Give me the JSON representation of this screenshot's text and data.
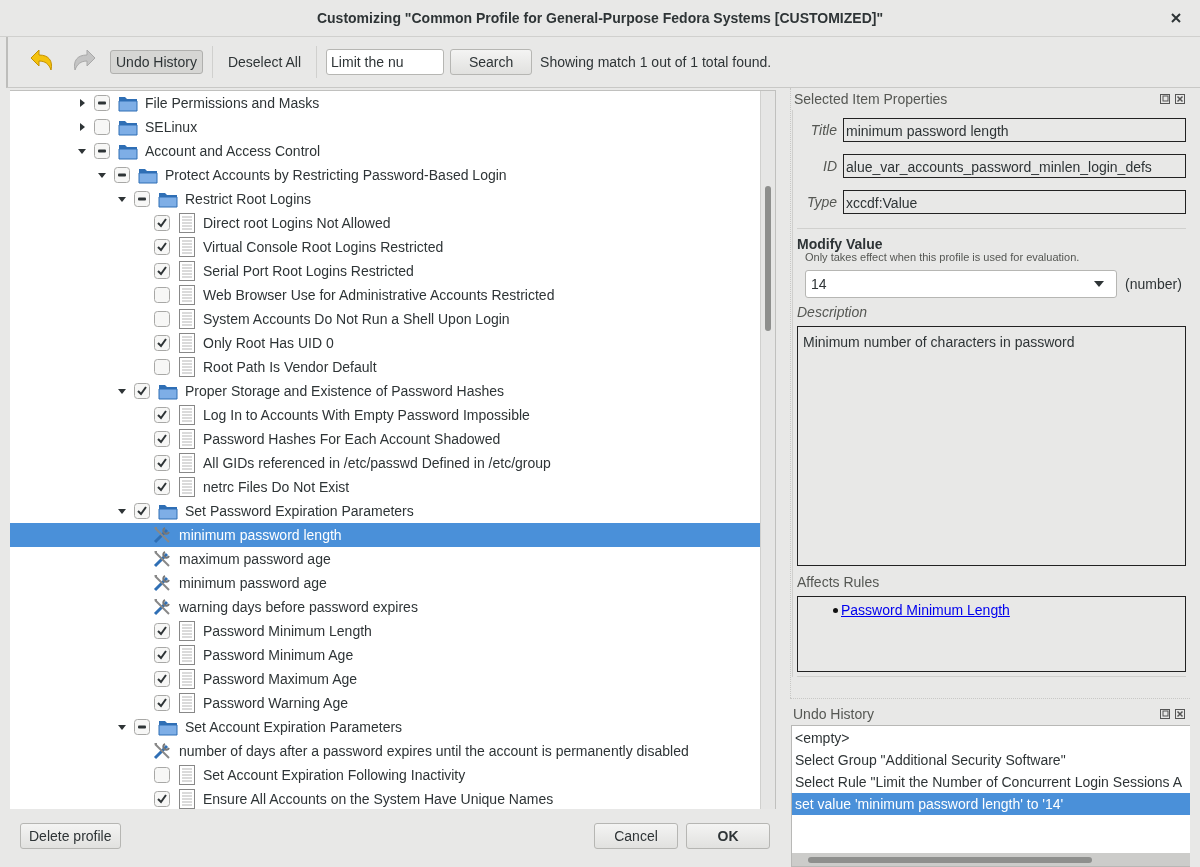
{
  "window": {
    "title": "Customizing \"Common Profile for General-Purpose Fedora Systems [CUSTOMIZED]\""
  },
  "toolbar": {
    "undo": {
      "disabled": false
    },
    "redo": {
      "disabled": true
    },
    "undo_history_toggle": {
      "label": "Undo History",
      "on": true
    },
    "deselect_all": "Deselect All",
    "search": {
      "value": "Limit the nu",
      "button": "Search"
    },
    "status": "Showing match 1 out of 1 total found."
  },
  "tree": [
    {
      "kind": "group",
      "label": "File Permissions and Masks",
      "expanded": false,
      "checked": false,
      "partial": true,
      "selected": false
    },
    {
      "kind": "group",
      "label": "SELinux",
      "expanded": false,
      "checked": false,
      "partial": false,
      "selected": false
    },
    {
      "kind": "group",
      "label": "Account and Access Control",
      "expanded": true,
      "checked": false,
      "partial": true,
      "selected": false,
      "children": [
        {
          "kind": "group",
          "label": "Protect Accounts by Restricting Password-Based Login",
          "expanded": true,
          "checked": false,
          "partial": true,
          "selected": false,
          "children": [
            {
              "kind": "group",
              "label": "Restrict Root Logins",
              "expanded": true,
              "checked": false,
              "partial": true,
              "selected": false,
              "children": [
                {
                  "kind": "rule",
                  "label": "Direct root Logins Not Allowed",
                  "checked": true,
                  "selected": false
                },
                {
                  "kind": "rule",
                  "label": "Virtual Console Root Logins Restricted",
                  "checked": true,
                  "selected": false
                },
                {
                  "kind": "rule",
                  "label": "Serial Port Root Logins Restricted",
                  "checked": true,
                  "selected": false
                },
                {
                  "kind": "rule",
                  "label": "Web Browser Use for Administrative Accounts Restricted",
                  "checked": false,
                  "selected": false
                },
                {
                  "kind": "rule",
                  "label": "System Accounts Do Not Run a Shell Upon Login",
                  "checked": false,
                  "selected": false
                },
                {
                  "kind": "rule",
                  "label": "Only Root Has UID 0",
                  "checked": true,
                  "selected": false
                },
                {
                  "kind": "rule",
                  "label": "Root Path Is Vendor Default",
                  "checked": false,
                  "selected": false
                }
              ]
            },
            {
              "kind": "group",
              "label": "Proper Storage and Existence of Password Hashes",
              "expanded": true,
              "checked": true,
              "selected": false,
              "children": [
                {
                  "kind": "rule",
                  "label": "Log In to Accounts With Empty Password Impossible",
                  "checked": true,
                  "selected": false
                },
                {
                  "kind": "rule",
                  "label": "Password Hashes For Each Account Shadowed",
                  "checked": true,
                  "selected": false
                },
                {
                  "kind": "rule",
                  "label": "All GIDs referenced in /etc/passwd Defined in /etc/group",
                  "checked": true,
                  "selected": false
                },
                {
                  "kind": "rule",
                  "label": "netrc Files Do Not Exist",
                  "checked": true,
                  "selected": false
                }
              ]
            },
            {
              "kind": "group",
              "label": "Set Password Expiration Parameters",
              "expanded": true,
              "checked": true,
              "selected": false,
              "children": [
                {
                  "kind": "value",
                  "label": "minimum password length",
                  "selected": true
                },
                {
                  "kind": "value",
                  "label": "maximum password age",
                  "selected": false
                },
                {
                  "kind": "value",
                  "label": "minimum password age",
                  "selected": false
                },
                {
                  "kind": "value",
                  "label": "warning days before password expires",
                  "selected": false
                },
                {
                  "kind": "rule",
                  "label": "Password Minimum Length",
                  "checked": true,
                  "selected": false
                },
                {
                  "kind": "rule",
                  "label": "Password Minimum Age",
                  "checked": true,
                  "selected": false
                },
                {
                  "kind": "rule",
                  "label": "Password Maximum Age",
                  "checked": true,
                  "selected": false
                },
                {
                  "kind": "rule",
                  "label": "Password Warning Age",
                  "checked": true,
                  "selected": false
                }
              ]
            },
            {
              "kind": "group",
              "label": "Set Account Expiration Parameters",
              "expanded": true,
              "checked": false,
              "partial": true,
              "selected": false,
              "children": [
                {
                  "kind": "value",
                  "label": "number of days after a password expires until the account is permanently disabled",
                  "selected": false
                },
                {
                  "kind": "rule",
                  "label": "Set Account Expiration Following Inactivity",
                  "checked": false,
                  "selected": false
                },
                {
                  "kind": "rule",
                  "label": "Ensure All Accounts on the System Have Unique Names",
                  "checked": true,
                  "selected": false
                }
              ]
            }
          ]
        }
      ]
    }
  ],
  "properties": {
    "header": "Selected Item Properties",
    "fields": [
      {
        "label": "Title",
        "value": "minimum password length"
      },
      {
        "label": "ID",
        "value": "alue_var_accounts_password_minlen_login_defs"
      },
      {
        "label": "Type",
        "value": "xccdf:Value"
      }
    ],
    "modify": {
      "heading": "Modify Value",
      "note": "Only takes effect when this profile is used for evaluation.",
      "value": "14",
      "unit": "(number)"
    },
    "description": {
      "label": "Description",
      "text": "Minimum number of characters in password"
    },
    "affects": {
      "label": "Affects Rules",
      "rules": [
        "Password Minimum Length"
      ]
    }
  },
  "undo_history": {
    "header": "Undo History",
    "items": [
      {
        "text": "<empty>",
        "selected": false
      },
      {
        "text": "Select Group \"Additional Security Software\"",
        "selected": false
      },
      {
        "text": "Select Rule \"Limit the Number of Concurrent Login Sessions A",
        "selected": false
      },
      {
        "text": "set value 'minimum password length' to '14'",
        "selected": true
      }
    ]
  },
  "buttons": {
    "delete": "Delete profile",
    "cancel": "Cancel",
    "ok": "OK"
  }
}
